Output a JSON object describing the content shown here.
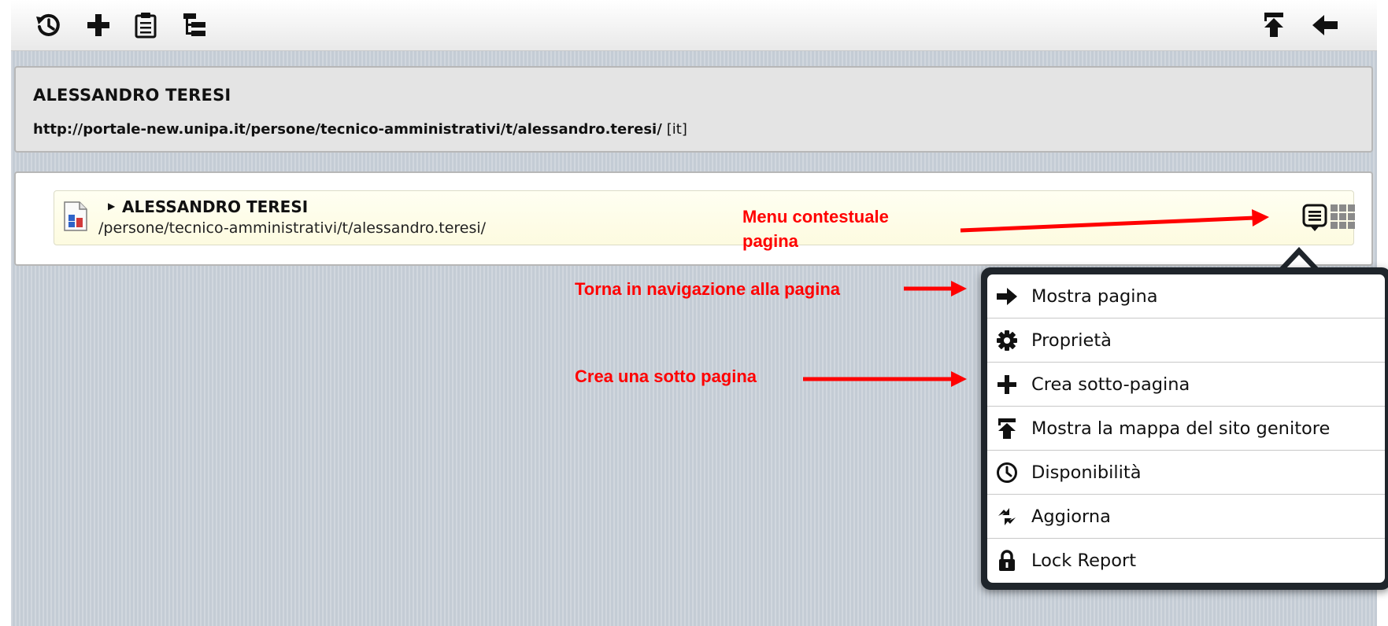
{
  "toolbar": {
    "left_icons": [
      "history-icon",
      "plus-icon",
      "clipboard-icon",
      "tree-structure-icon"
    ],
    "right_icons": [
      "parent-sitemap-icon",
      "back-arrow-icon"
    ]
  },
  "header": {
    "title": "ALESSANDRO TERESI",
    "url": "http://portale-new.unipa.it/persone/tecnico-amministrativi/t/alessandro.teresi/",
    "lang": "[it]"
  },
  "tree": {
    "node_title": "ALESSANDRO TERESI",
    "node_path": "/persone/tecnico-amministrativi/t/alessandro.teresi/",
    "icons": [
      "page-icon",
      "context-menu-icon",
      "grid-icon"
    ]
  },
  "annotations": {
    "context_menu_line1": "Menu contestuale",
    "context_menu_line2": "pagina",
    "back_to_page": "Torna in navigazione alla pagina",
    "create_subpage": "Crea una sotto pagina",
    "color": "#ff0000"
  },
  "context_menu": {
    "items": [
      {
        "label": "Mostra pagina",
        "icon": "arrow-right-icon"
      },
      {
        "label": "Proprietà",
        "icon": "gear-icon"
      },
      {
        "label": "Crea sotto-pagina",
        "icon": "plus-icon"
      },
      {
        "label": "Mostra la mappa del sito genitore",
        "icon": "parent-sitemap-icon"
      },
      {
        "label": "Disponibilità",
        "icon": "clock-icon"
      },
      {
        "label": "Aggiorna",
        "icon": "refresh-icon"
      },
      {
        "label": "Lock Report",
        "icon": "lock-icon"
      }
    ]
  }
}
